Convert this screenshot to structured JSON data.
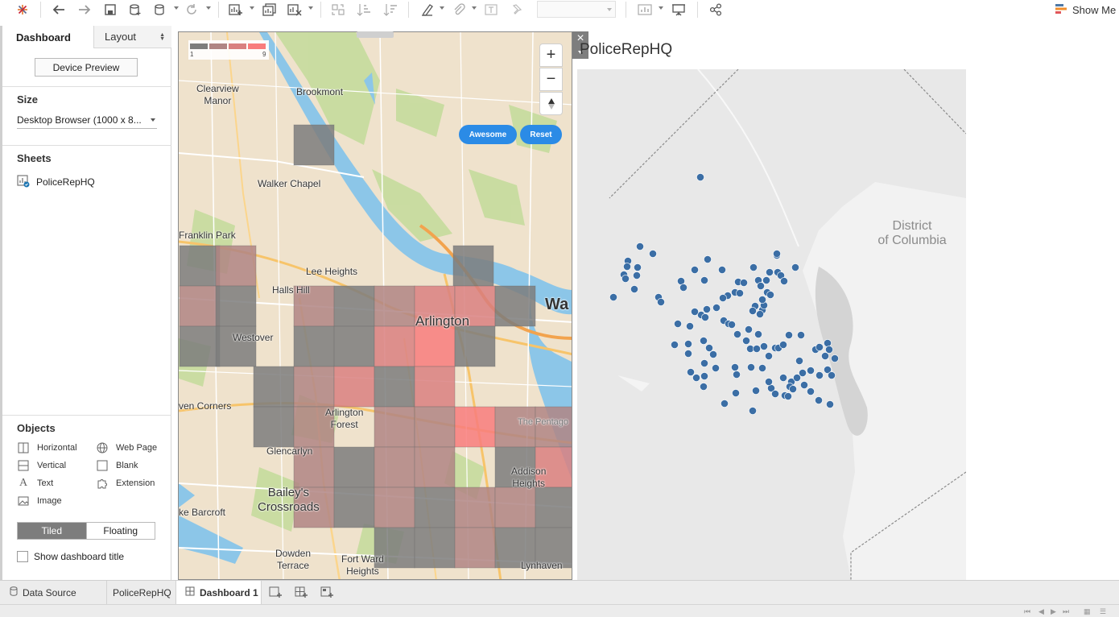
{
  "toolbar": {
    "show_me_label": "Show Me",
    "icons": [
      "tableau-logo-icon",
      "undo-icon",
      "redo-icon",
      "save-icon",
      "new-data-source-icon",
      "pause-updates-icon",
      "refresh-icon",
      "new-worksheet-icon",
      "duplicate-sheet-icon",
      "clear-sheet-icon",
      "swap-axes-icon",
      "sort-ascending-icon",
      "sort-descending-icon",
      "highlight-icon",
      "group-icon",
      "labels-icon",
      "fix-axes-icon",
      "fit-combo",
      "show-cards-icon",
      "presentation-mode-icon",
      "share-icon"
    ]
  },
  "left_panel": {
    "tabs": {
      "dashboard": "Dashboard",
      "layout": "Layout"
    },
    "device_preview_label": "Device Preview",
    "size": {
      "title": "Size",
      "value": "Desktop Browser (1000 x 8..."
    },
    "sheets": {
      "title": "Sheets",
      "items": [
        "PoliceRepHQ"
      ]
    },
    "objects": {
      "title": "Objects",
      "items": {
        "horizontal": "Horizontal",
        "web_page": "Web Page",
        "vertical": "Vertical",
        "blank": "Blank",
        "text": "Text",
        "extension": "Extension",
        "image": "Image"
      }
    },
    "tiled_label": "Tiled",
    "floating_label": "Floating",
    "show_title_label": "Show dashboard title"
  },
  "webmap": {
    "legend": {
      "min": "1",
      "max": "9",
      "colors": [
        "#7d7d7d",
        "#b08584",
        "#d98080",
        "#f87c7c"
      ]
    },
    "buttons": {
      "awesome": "Awesome",
      "reset": "Reset"
    },
    "zoom_in": "+",
    "zoom_out": "−",
    "labels": {
      "clearview": "Clearview\nManor",
      "brookmont": "Brookmont",
      "walker_chapel": "Walker Chapel",
      "franklin_park": "Franklin Park",
      "lee_heights": "Lee Heights",
      "halls_hill": "Halls Hill",
      "westover": "Westover",
      "arlington": "Arlington",
      "wa": "Wa",
      "seven_corners": "ven Corners",
      "arlington_forest": "Arlington\nForest",
      "pentagon": "The Pentago",
      "glencarlyn": "Glencarlyn",
      "addison_heights": "Addison\nHeights",
      "baileys": "Bailey's\nCrossroads",
      "barcroft": "ke Barcroft",
      "dowden_terrace": "Dowden\nTerrace",
      "fort_ward": "Fort Ward\nHeights",
      "lynhaven": "Lynhaven"
    }
  },
  "sheet": {
    "title": "PoliceRepHQ",
    "district_label": "District\nof Columbia",
    "point_color": "#3b6ea5"
  },
  "bottom_tabs": {
    "data_source": "Data Source",
    "police": "PoliceRepHQ",
    "dashboard": "Dashboard 1"
  }
}
